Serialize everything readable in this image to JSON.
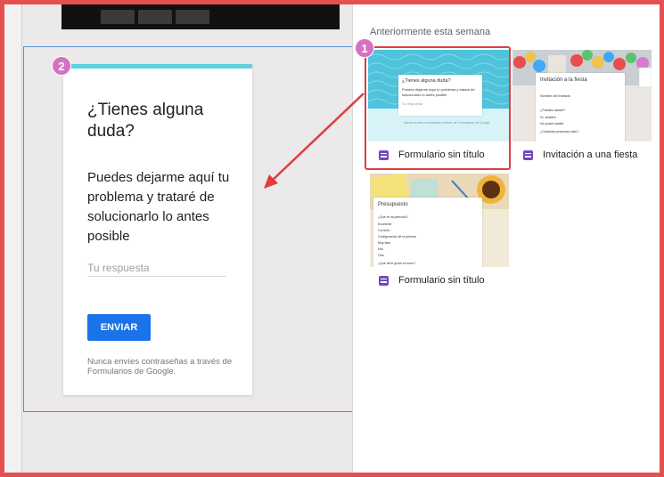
{
  "left": {
    "badge": "2",
    "card": {
      "question": "¿Tienes alguna duda?",
      "description": "Puedes dejarme aquí tu problema y trataré de solucionarlo lo antes posible",
      "answer_placeholder": "Tu respuesta",
      "submit_label": "ENVIAR",
      "footer_note": "Nunca envíes contraseñas a través de Formularios de Google.",
      "accent_color": "#5ed0df"
    }
  },
  "right": {
    "section_title": "Anteriormente esta semana",
    "badge": "1",
    "tiles": [
      {
        "label": "Formulario sin título",
        "icon": "google-forms-icon",
        "preview_title": "¿Tienes alguna duda?",
        "preview_text": "Puedes dejarme aquí tu problema y trataré de solucionarlo lo antes posible",
        "preview_answer": "Tu respuesta",
        "preview_footer": "Nunca envíes contraseñas a través de Formularios de Google."
      },
      {
        "label": "Invitación a una fiesta",
        "icon": "google-forms-icon",
        "preview_title": "Invitación a la fiesta",
        "preview_lines": [
          "Nombre del invitado",
          "¿Puedes asistir?",
          "Sí, asistiré",
          "No podré asistir",
          "¿Cuántas personas vais?"
        ]
      },
      {
        "label": "Formulario sin título",
        "icon": "google-forms-icon",
        "preview_title": "Presupuesto",
        "preview_lines": [
          "¿Qué te ha parecido?",
          "Excelente",
          "Correcto",
          "Configuración de la primera",
          "Muy bien",
          "Mal",
          "Otro",
          "¿Qué tal te gustó el curso?"
        ]
      }
    ]
  },
  "colors": {
    "frame": "#e5504f",
    "highlight": "#e03c3f",
    "selection": "#5b8fd8",
    "badge": "#d571c5",
    "button": "#1a73e8",
    "forms_purple": "#7248b9"
  }
}
